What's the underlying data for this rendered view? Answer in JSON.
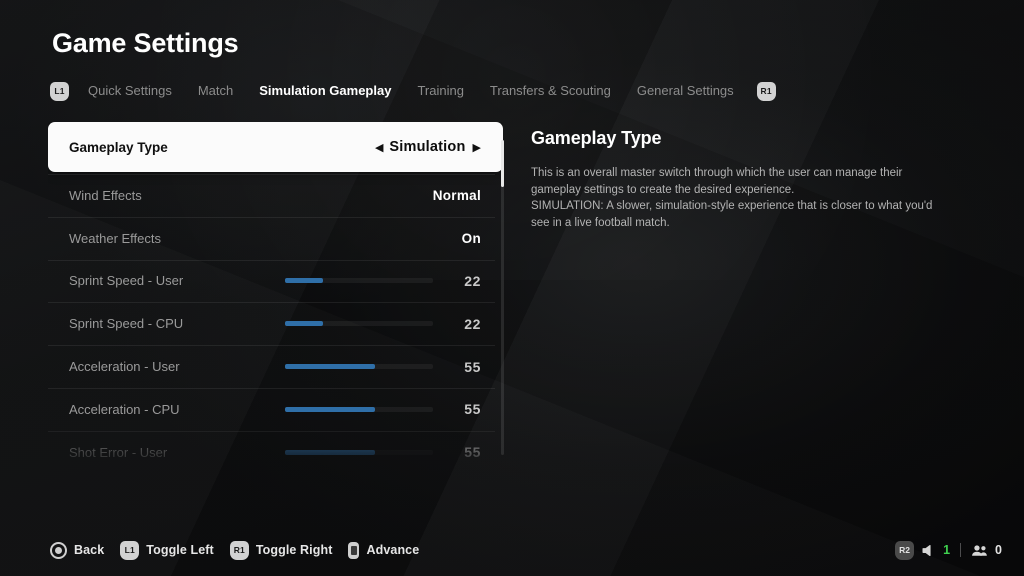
{
  "header": {
    "title": "Game Settings"
  },
  "tabs": {
    "left_badge": "L1",
    "right_badge": "R1",
    "items": [
      {
        "label": "Quick Settings",
        "active": false
      },
      {
        "label": "Match",
        "active": false
      },
      {
        "label": "Simulation Gameplay",
        "active": true
      },
      {
        "label": "Training",
        "active": false
      },
      {
        "label": "Transfers & Scouting",
        "active": false
      },
      {
        "label": "General Settings",
        "active": false
      }
    ]
  },
  "settings_list": {
    "arrow_left": "◀",
    "arrow_right": "▶",
    "rows": [
      {
        "label": "Gameplay Type",
        "type": "selector",
        "value": "Simulation",
        "selected": true
      },
      {
        "label": "Wind Effects",
        "type": "value",
        "value": "Normal",
        "selected": false
      },
      {
        "label": "Weather Effects",
        "type": "value",
        "value": "On",
        "selected": false
      },
      {
        "label": "Sprint Speed - User",
        "type": "slider",
        "value": "22",
        "fill_pct": 26,
        "selected": false
      },
      {
        "label": "Sprint Speed - CPU",
        "type": "slider",
        "value": "22",
        "fill_pct": 26,
        "selected": false
      },
      {
        "label": "Acceleration - User",
        "type": "slider",
        "value": "55",
        "fill_pct": 61,
        "selected": false
      },
      {
        "label": "Acceleration - CPU",
        "type": "slider",
        "value": "55",
        "fill_pct": 61,
        "selected": false
      },
      {
        "label": "Shot Error - User",
        "type": "slider",
        "value": "55",
        "fill_pct": 61,
        "selected": false
      }
    ],
    "scroll_thumb_pct": 15
  },
  "detail": {
    "title": "Gameplay Type",
    "paragraphs": [
      "This is an overall master switch through which the user can manage their gameplay settings to create the desired experience.",
      "SIMULATION: A slower, simulation-style experience that is closer to what you'd see in a live football match."
    ]
  },
  "bottom_bar": {
    "actions": [
      {
        "icon": "circle-button-icon",
        "label": "Back"
      },
      {
        "icon": "l1-button-icon",
        "badge": "L1",
        "label": "Toggle Left"
      },
      {
        "icon": "r1-button-icon",
        "badge": "R1",
        "label": "Toggle Right"
      },
      {
        "icon": "touchpad-button-icon",
        "label": "Advance"
      }
    ],
    "status": {
      "badge": "R2",
      "volume_value": "1",
      "players_value": "0"
    }
  },
  "colors": {
    "accent_slider": "#2f6fa8",
    "selected_row_bg": "#fbfbfb",
    "status_green": "#3fd14f",
    "background": "#0b0b0c"
  }
}
